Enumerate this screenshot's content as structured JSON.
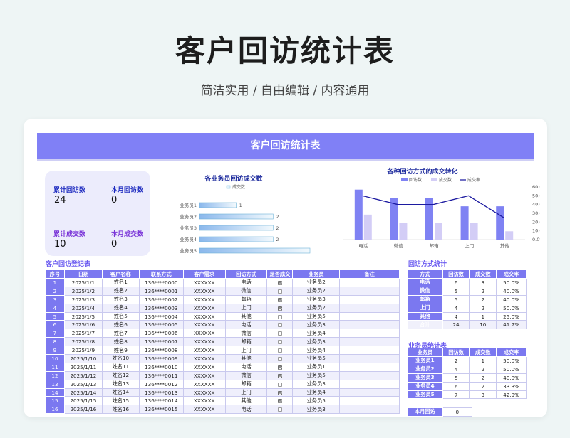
{
  "hero": {
    "title": "客户回访统计表",
    "subtitle": "简洁实用 / 自由编辑 / 内容通用"
  },
  "banner": {
    "title": "客户回访统计表"
  },
  "stats": [
    {
      "label": "累计回访数",
      "value": "24",
      "color": "#1f2cc0"
    },
    {
      "label": "本月回访数",
      "value": "0",
      "color": "#1f2cc0"
    },
    {
      "label": "累计成交数",
      "value": "10",
      "color": "#7a35d8"
    },
    {
      "label": "本月成交数",
      "value": "0",
      "color": "#7a35d8"
    }
  ],
  "chart_data": [
    {
      "type": "bar",
      "orientation": "horizontal",
      "title": "各业务员回访成交数",
      "legend": [
        "成交数"
      ],
      "categories": [
        "业务员1",
        "业务员2",
        "业务员3",
        "业务员4",
        "业务员5"
      ],
      "values": [
        1,
        2,
        2,
        2,
        3
      ],
      "xlim": [
        0,
        3
      ]
    },
    {
      "type": "bar+line",
      "title": "各种回访方式的成交转化",
      "categories": [
        "电话",
        "微信",
        "邮箱",
        "上门",
        "其他"
      ],
      "series": [
        {
          "name": "回访数",
          "type": "bar",
          "values": [
            6,
            5,
            5,
            4,
            4
          ],
          "color": "#7f82f3"
        },
        {
          "name": "成交数",
          "type": "bar",
          "values": [
            3,
            2,
            2,
            2,
            1
          ],
          "color": "#d3cdf6"
        },
        {
          "name": "成交率",
          "type": "line",
          "axis": "right",
          "values": [
            0.5,
            0.4,
            0.4,
            0.5,
            0.25
          ],
          "color": "#1c1aa0"
        }
      ],
      "left_ylim": [
        0,
        7
      ],
      "right_ylim": [
        0,
        0.6
      ],
      "right_ticks": [
        "60.0%",
        "50.0%",
        "40.0%",
        "30.0%",
        "20.0%",
        "10.0%",
        "0.0%"
      ]
    }
  ],
  "register": {
    "title": "客户回访登记表",
    "headers": [
      "序号",
      "日期",
      "客户名称",
      "联系方式",
      "客户需求",
      "回访方式",
      "是否成交",
      "业务员",
      "备注"
    ],
    "rows": [
      [
        "1",
        "2025/1/1",
        "姓名1",
        "136****0000",
        "XXXXXX",
        "电话",
        true,
        "业务员2",
        ""
      ],
      [
        "2",
        "2025/1/2",
        "姓名2",
        "136****0001",
        "XXXXXX",
        "微信",
        false,
        "业务员2",
        ""
      ],
      [
        "3",
        "2025/1/3",
        "姓名3",
        "136****0002",
        "XXXXXX",
        "邮箱",
        true,
        "业务员3",
        ""
      ],
      [
        "4",
        "2025/1/4",
        "姓名4",
        "136****0003",
        "XXXXXX",
        "上门",
        true,
        "业务员2",
        ""
      ],
      [
        "5",
        "2025/1/5",
        "姓名5",
        "136****0004",
        "XXXXXX",
        "其他",
        false,
        "业务员5",
        ""
      ],
      [
        "6",
        "2025/1/6",
        "姓名6",
        "136****0005",
        "XXXXXX",
        "电话",
        false,
        "业务员3",
        ""
      ],
      [
        "7",
        "2025/1/7",
        "姓名7",
        "136****0006",
        "XXXXXX",
        "微信",
        false,
        "业务员4",
        ""
      ],
      [
        "8",
        "2025/1/8",
        "姓名8",
        "136****0007",
        "XXXXXX",
        "邮箱",
        false,
        "业务员3",
        ""
      ],
      [
        "9",
        "2025/1/9",
        "姓名9",
        "136****0008",
        "XXXXXX",
        "上门",
        false,
        "业务员4",
        ""
      ],
      [
        "10",
        "2025/1/10",
        "姓名10",
        "136****0009",
        "XXXXXX",
        "其他",
        false,
        "业务员5",
        ""
      ],
      [
        "11",
        "2025/1/11",
        "姓名11",
        "136****0010",
        "XXXXXX",
        "电话",
        true,
        "业务员1",
        ""
      ],
      [
        "12",
        "2025/1/12",
        "姓名12",
        "136****0011",
        "XXXXXX",
        "微信",
        true,
        "业务员5",
        ""
      ],
      [
        "13",
        "2025/1/13",
        "姓名13",
        "136****0012",
        "XXXXXX",
        "邮箱",
        false,
        "业务员3",
        ""
      ],
      [
        "14",
        "2025/1/14",
        "姓名14",
        "136****0013",
        "XXXXXX",
        "上门",
        true,
        "业务员4",
        ""
      ],
      [
        "15",
        "2025/1/15",
        "姓名15",
        "136****0014",
        "XXXXXX",
        "其他",
        true,
        "业务员5",
        ""
      ],
      [
        "16",
        "2025/1/16",
        "姓名16",
        "136****0015",
        "XXXXXX",
        "电话",
        false,
        "业务员3",
        ""
      ]
    ]
  },
  "method_stats": {
    "title": "回访方式统计",
    "headers": [
      "方式",
      "回访数",
      "成交数",
      "成交率"
    ],
    "rows": [
      [
        "电话",
        "6",
        "3",
        "50.0%"
      ],
      [
        "微信",
        "5",
        "2",
        "40.0%"
      ],
      [
        "邮箱",
        "5",
        "2",
        "40.0%"
      ],
      [
        "上门",
        "4",
        "2",
        "50.0%"
      ],
      [
        "其他",
        "4",
        "1",
        "25.0%"
      ],
      [
        "合计",
        "24",
        "10",
        "41.7%"
      ]
    ]
  },
  "staff_stats": {
    "title": "业务员统计表",
    "headers": [
      "业务员",
      "回访数",
      "成交数",
      "成交率"
    ],
    "rows": [
      [
        "业务员1",
        "2",
        "1",
        "50.0%"
      ],
      [
        "业务员2",
        "4",
        "2",
        "50.0%"
      ],
      [
        "业务员3",
        "5",
        "2",
        "40.0%"
      ],
      [
        "业务员4",
        "6",
        "2",
        "33.3%"
      ],
      [
        "业务员5",
        "7",
        "3",
        "42.9%"
      ]
    ]
  },
  "monthly": {
    "label": "本月回访",
    "value": "0"
  }
}
